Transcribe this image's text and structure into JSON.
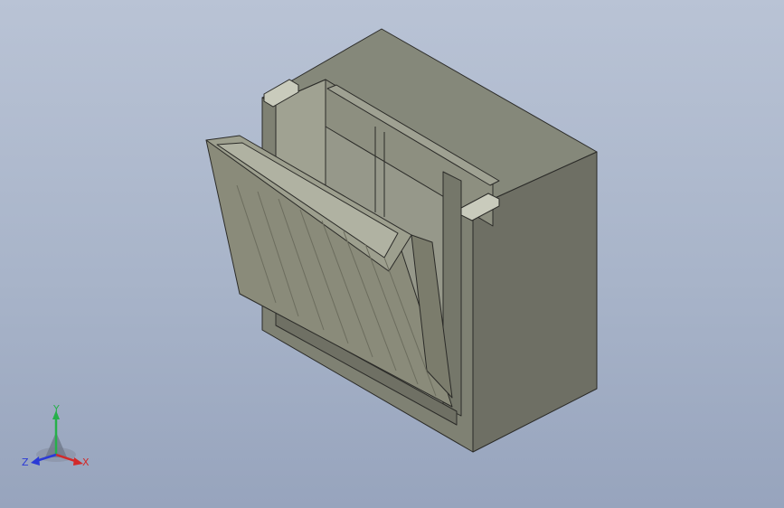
{
  "viewport": {
    "background_top": "#b9c3d5",
    "background_bottom": "#97a4bd"
  },
  "model": {
    "description_icon": "sluice-gate-box-3d-icon",
    "colors": {
      "face_right": "#6e6f64",
      "face_top": "#85887a",
      "face_front": "#7f8173",
      "interior": "#8d8f80",
      "gate_panel": "#8a8b7a",
      "edge": "#2b2b28"
    }
  },
  "triad": {
    "y_label": "Y",
    "x_label": "X",
    "z_label": "Z",
    "colors": {
      "x": "#d22a2a",
      "y": "#26b04a",
      "z": "#2b3ad6"
    }
  }
}
